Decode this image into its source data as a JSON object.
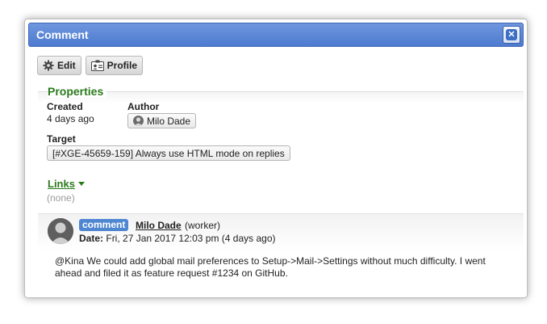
{
  "window": {
    "title": "Comment"
  },
  "toolbar": {
    "edit_label": "Edit",
    "profile_label": "Profile"
  },
  "properties": {
    "section_title": "Properties",
    "created_label": "Created",
    "created_value": "4 days ago",
    "author_label": "Author",
    "author_value": "Milo Dade",
    "target_label": "Target",
    "target_value": "[#XGE-45659-159] Always use HTML mode on replies"
  },
  "links": {
    "title": "Links",
    "empty_text": "(none)"
  },
  "comment": {
    "badge": "comment",
    "author": "Milo Dade",
    "role": "(worker)",
    "date_label": "Date:",
    "date_value": "Fri, 27 Jan 2017 12:03 pm (4 days ago)",
    "body": "@Kina We could add global mail preferences to Setup->Mail->Settings without much difficulty. I went ahead and filed it as feature request #1234 on GitHub."
  },
  "colors": {
    "titlebar": "#5b86d6",
    "section_green": "#2a7a1c",
    "badge_blue": "#4f86d1"
  },
  "icons": [
    "close-icon",
    "gear-icon",
    "id-card-icon",
    "avatar",
    "caret-down-icon"
  ]
}
